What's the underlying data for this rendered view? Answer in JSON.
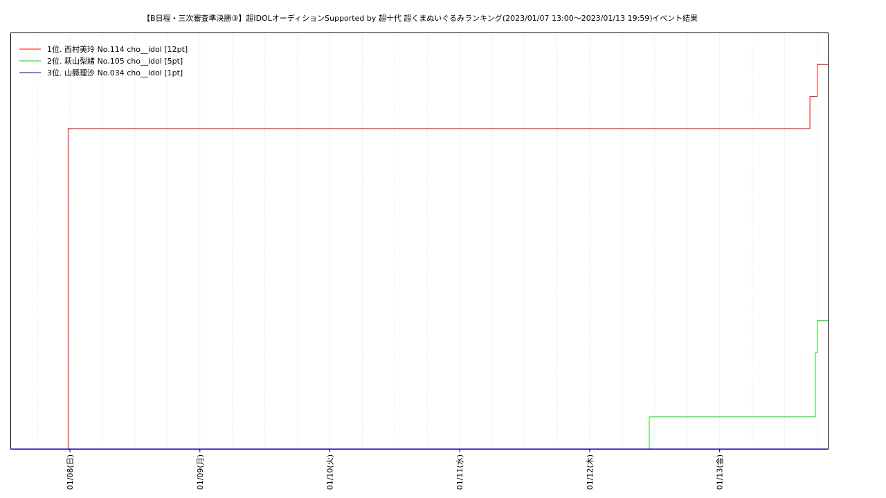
{
  "chart_data": {
    "type": "line",
    "title": "【B日程・三次審査準決勝③】超IDOLオーディションSupported by 超十代 超くまぬいぐるみランキング(2023/01/07 13:00～2023/01/13 19:59)",
    "subtitle": "イベント結果",
    "x_range": [
      "2023-01-07 13:00",
      "2023-01-13 19:59"
    ],
    "ylim": [
      0,
      13
    ],
    "grid": "vertical dotted",
    "legend_position": "top-left",
    "tick_labels": [
      "01/08(日)",
      "01/09(月)",
      "01/10(火)",
      "01/11(水)",
      "01/12(木)",
      "01/13(金)"
    ],
    "tick_dates": [
      "2023-01-08 00:00",
      "2023-01-09 00:00",
      "2023-01-10 00:00",
      "2023-01-11 00:00",
      "2023-01-12 00:00",
      "2023-01-13 00:00"
    ],
    "series": [
      {
        "name": "1位. 西村美玲 No.114 cho__idol [12pt]",
        "color": "#ff0000",
        "points": [
          [
            "2023-01-07 13:00",
            0
          ],
          [
            "2023-01-07 23:40",
            0
          ],
          [
            "2023-01-07 23:40",
            10
          ],
          [
            "2023-01-13 16:40",
            10
          ],
          [
            "2023-01-13 16:40",
            11
          ],
          [
            "2023-01-13 18:00",
            11
          ],
          [
            "2023-01-13 18:00",
            12
          ],
          [
            "2023-01-13 19:59",
            12
          ]
        ]
      },
      {
        "name": "2位. 萩山梨緒 No.105 cho__idol [5pt]",
        "color": "#00dd00",
        "points": [
          [
            "2023-01-07 13:00",
            0
          ],
          [
            "2023-01-12 11:00",
            0
          ],
          [
            "2023-01-12 11:00",
            1
          ],
          [
            "2023-01-13 17:40",
            1
          ],
          [
            "2023-01-13 17:40",
            3
          ],
          [
            "2023-01-13 18:00",
            3
          ],
          [
            "2023-01-13 18:00",
            4
          ],
          [
            "2023-01-13 19:59",
            4
          ]
        ]
      },
      {
        "name": "3位. 山縣理沙 No.034 cho__idol [1pt]",
        "color": "#0000cc",
        "points": [
          [
            "2023-01-07 13:00",
            0
          ],
          [
            "2023-01-13 19:59",
            0
          ]
        ]
      }
    ]
  }
}
